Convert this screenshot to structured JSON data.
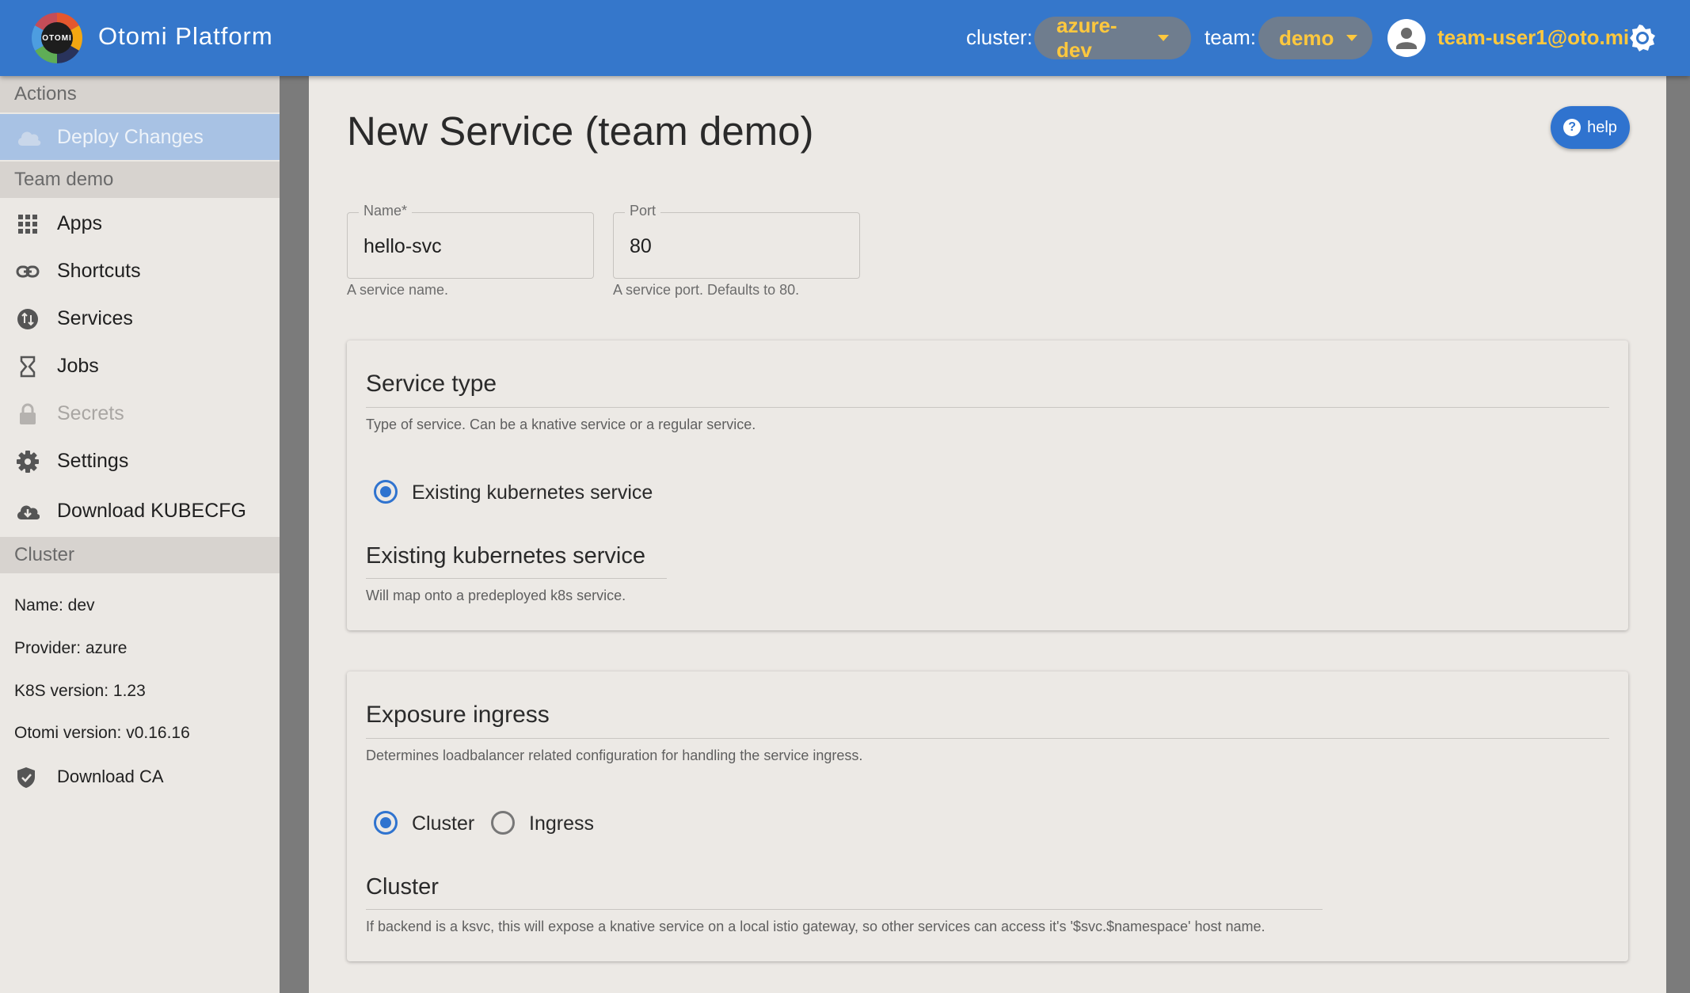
{
  "header": {
    "brand": "Otomi Platform",
    "logo_text": "OTOMI",
    "cluster_label": "cluster:",
    "cluster_value": "azure-dev",
    "team_label": "team:",
    "team_value": "demo",
    "user": "team-user1@oto.mi"
  },
  "sidebar": {
    "actions_head": "Actions",
    "deploy_label": "Deploy Changes",
    "team_head": "Team demo",
    "items": [
      {
        "label": "Apps",
        "icon": "apps-grid-icon"
      },
      {
        "label": "Shortcuts",
        "icon": "link-icon"
      },
      {
        "label": "Services",
        "icon": "services-icon"
      },
      {
        "label": "Jobs",
        "icon": "hourglass-icon"
      },
      {
        "label": "Secrets",
        "icon": "lock-icon"
      },
      {
        "label": "Settings",
        "icon": "gear-icon"
      },
      {
        "label": "Download KUBECFG",
        "icon": "cloud-download-icon"
      }
    ],
    "cluster_head": "Cluster",
    "cluster_info": {
      "name": "Name: dev",
      "provider": "Provider: azure",
      "k8s": "K8S version: 1.23",
      "otomi": "Otomi version: v0.16.16"
    },
    "download_ca": "Download CA"
  },
  "main": {
    "title": "New Service (team demo)",
    "help_label": "help",
    "name_field": {
      "label": "Name",
      "required_mark": "*",
      "value": "hello-svc",
      "helper": "A service name."
    },
    "port_field": {
      "label": "Port",
      "value": "80",
      "helper": "A service port. Defaults to 80."
    },
    "service_type": {
      "title": "Service type",
      "desc": "Type of service. Can be a knative service or a regular service.",
      "option": "Existing kubernetes service",
      "sub_title": "Existing kubernetes service",
      "sub_desc": "Will map onto a predeployed k8s service."
    },
    "exposure": {
      "title": "Exposure ingress",
      "desc": "Determines loadbalancer related configuration for handling the service ingress.",
      "option_cluster": "Cluster",
      "option_ingress": "Ingress",
      "sub_title": "Cluster",
      "sub_desc": "If backend is a ksvc, this will expose a knative service on a local istio gateway, so other services can access it's '$svc.$namespace' host name."
    }
  },
  "colors": {
    "appbar": "#3577cb",
    "accent": "#2f73cf",
    "highlight": "#ffc83d"
  }
}
